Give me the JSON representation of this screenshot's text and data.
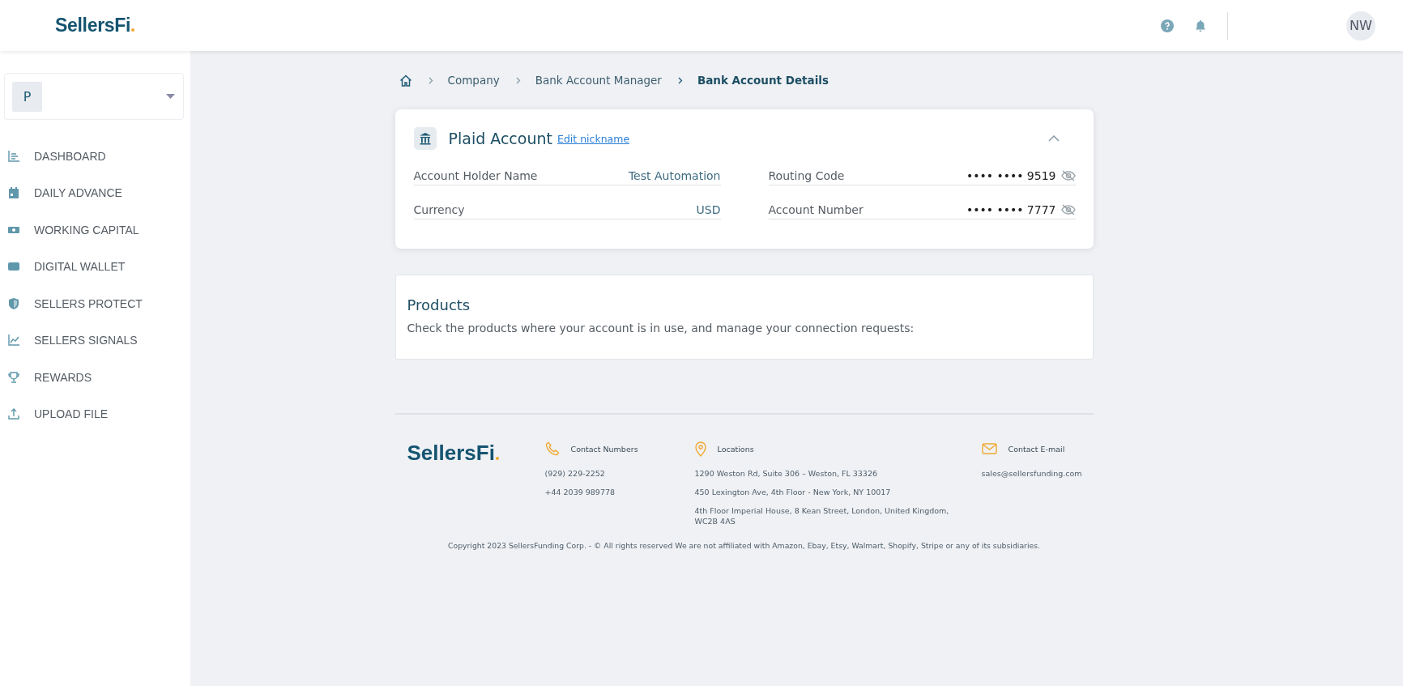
{
  "header": {
    "logo": "SellersFi",
    "avatar": "NW"
  },
  "sidebar": {
    "account_initial": "P",
    "items": [
      {
        "label": "DASHBOARD",
        "selected": false
      },
      {
        "label": "DAILY ADVANCE",
        "selected": false
      },
      {
        "label": "WORKING CAPITAL",
        "selected": false
      },
      {
        "label": "DIGITAL WALLET",
        "selected": false
      },
      {
        "label": "SELLERS PROTECT",
        "selected": false
      },
      {
        "label": "SELLERS SIGNALS",
        "selected": false
      },
      {
        "label": "REWARDS",
        "selected": false
      },
      {
        "label": "UPLOAD FILE",
        "selected": false
      }
    ]
  },
  "breadcrumb": [
    "Company",
    "Bank Account Manager",
    "Bank Account Details"
  ],
  "account_card": {
    "title": "Plaid Account",
    "edit_link": "Edit nickname",
    "expanded": true,
    "fields": [
      {
        "label": "Account Holder Name",
        "value": "Test Automation",
        "kind": "text"
      },
      {
        "label": "Routing Code",
        "value": "•••• •••• 9519",
        "kind": "masked"
      },
      {
        "label": "Currency",
        "value": "USD",
        "kind": "text"
      },
      {
        "label": "Account Number",
        "value": "•••• •••• 7777",
        "kind": "masked"
      }
    ]
  },
  "products": {
    "title": "Products",
    "description": "Check the products where your account is in use, and manage your connection requests:"
  },
  "footer": {
    "logo": "SellersFi",
    "columns": [
      {
        "kind": "phone",
        "heading": "Contact Numbers",
        "lines": [
          "(929) 229-2252",
          "+44 2039 989778"
        ]
      },
      {
        "kind": "location",
        "heading": "Locations",
        "lines": [
          "1290 Weston Rd, Suite 306 – Weston, FL 33326",
          "450 Lexington Ave, 4th Floor - New York, NY 10017",
          "4th Floor Imperial House, 8 Kean Street, London, United Kingdom, WC2B 4AS"
        ]
      },
      {
        "kind": "email",
        "heading": "Contact E-mail",
        "lines": [
          "sales@sellersfunding.com"
        ]
      }
    ],
    "copyright": "Copyright 2023 SellersFunding Corp. - © All rights reserved We are not affiliated with Amazon, Ebay, Etsy, Walmart, Shopify, Stripe or any of its subsidiaries."
  }
}
